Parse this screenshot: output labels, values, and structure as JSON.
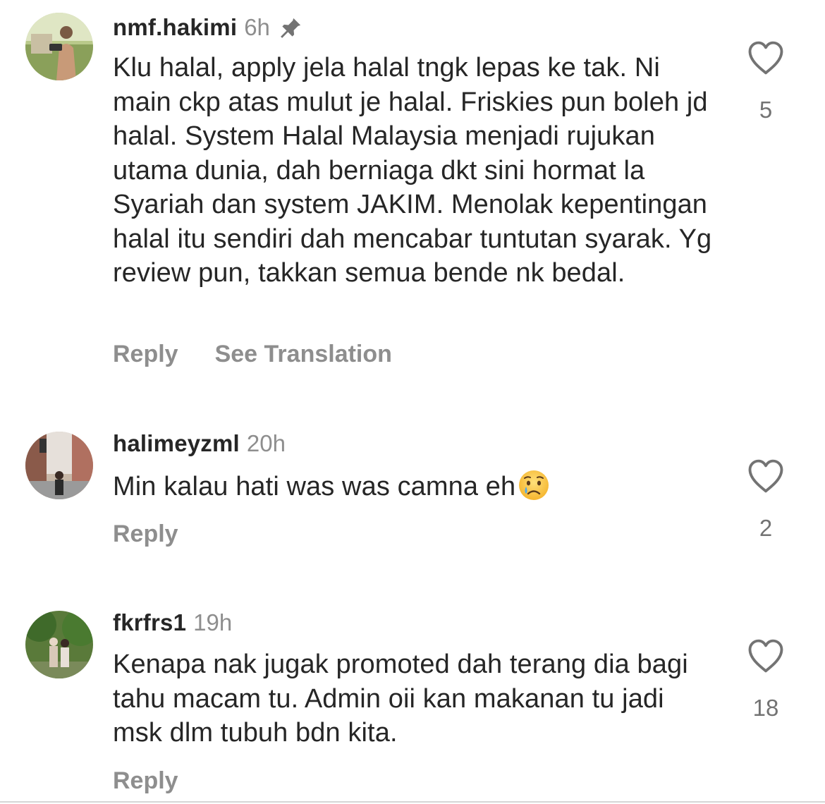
{
  "comments": [
    {
      "username": "nmf.hakimi",
      "time": "6h",
      "pinned": true,
      "avatar_icon": "profile-photo-man-with-camera",
      "text": "Klu halal, apply jela halal tngk lepas ke tak. Ni main ckp atas mulut je halal. Friskies pun boleh jd halal. System Halal Malaysia menjadi rujukan utama dunia, dah berniaga dkt sini hormat la Syariah dan system JAKIM. Menolak kepentingan halal itu sendiri dah mencabar tuntutan syarak. Yg review pun, takkan semua bende nk bedal.",
      "reply_label": "Reply",
      "translate_label": "See Translation",
      "likes": "5"
    },
    {
      "username": "halimeyzml",
      "time": "20h",
      "pinned": false,
      "avatar_icon": "profile-photo-city-street",
      "text": "Min kalau hati was was camna eh",
      "emoji": "crying-face-emoji",
      "reply_label": "Reply",
      "likes": "2"
    },
    {
      "username": "fkrfrs1",
      "time": "19h",
      "pinned": false,
      "avatar_icon": "profile-photo-couple-garden",
      "text": "Kenapa nak jugak promoted dah terang dia bagi tahu macam tu. Admin oii kan makanan tu jadi msk dlm tubuh bdn kita.",
      "reply_label": "Reply",
      "likes": "18"
    }
  ],
  "colors": {
    "text": "#262626",
    "secondary": "#8e8e8e",
    "background": "#ffffff"
  }
}
